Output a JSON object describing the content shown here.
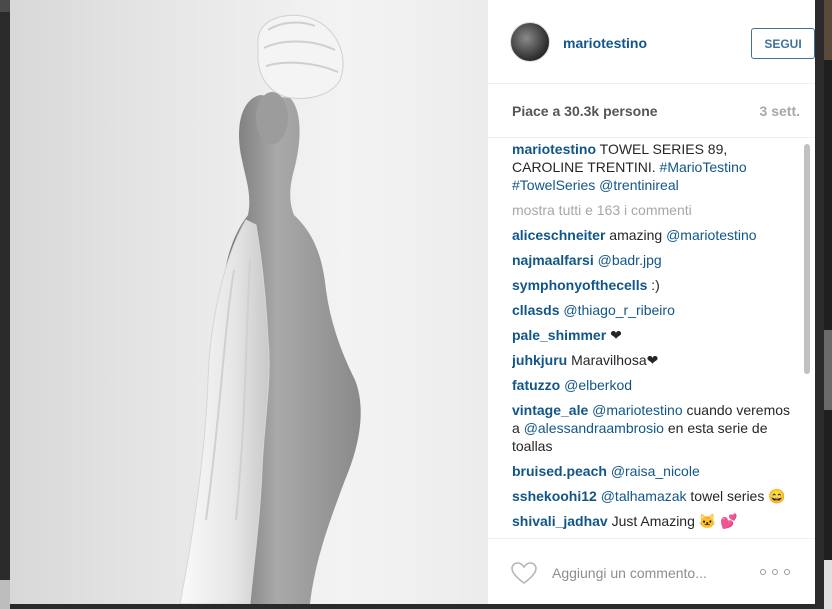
{
  "post": {
    "username": "mariotestino",
    "follow_label": "SEGUI",
    "likes": "Piace a 30.3k persone",
    "time": "3 sett."
  },
  "caption": {
    "user": "mariotestino",
    "text": "TOWEL SERIES 89, CAROLINE TRENTINI.",
    "tags": [
      "#MarioTestino",
      "#TowelSeries",
      "@trentinireal"
    ]
  },
  "view_all": "mostra tutti e 163 i commenti",
  "comments": [
    {
      "user": "aliceschneiter",
      "text": "amazing ",
      "tag": "@mariotestino"
    },
    {
      "user": "najmaalfarsi",
      "text": "",
      "tag": "@badr.jpg"
    },
    {
      "user": "symphonyofthecells",
      "text": ":)",
      "tag": ""
    },
    {
      "user": "cllasds",
      "text": "",
      "tag": "@thiago_r_ribeiro"
    },
    {
      "user": "pale_shimmer",
      "text": "❤",
      "tag": ""
    },
    {
      "user": "juhkjuru",
      "text": "Maravilhosa❤",
      "tag": ""
    },
    {
      "user": "fatuzzo",
      "text": "",
      "tag": "@elberkod"
    },
    {
      "user": "vintage_ale",
      "text_before": "",
      "tag1": "@mariotestino",
      "text_mid": " cuando veremos a ",
      "tag2": "@alessandraambrosio",
      "text_after": " en esta serie de toallas"
    },
    {
      "user": "bruised.peach",
      "text": "",
      "tag": "@raisa_nicole"
    },
    {
      "user": "sshekoohi12",
      "text_before": "",
      "tag1": "@talhamazak",
      "text_mid": " towel series 😄",
      "tag2": "",
      "text_after": ""
    },
    {
      "user": "shivali_jadhav",
      "text": "Just Amazing 🐱 💕",
      "tag": ""
    }
  ],
  "footer": {
    "comment_placeholder": "Aggiungi un commento...",
    "heart_icon": "heart-outline-icon",
    "more_icon": "more-options-icon"
  },
  "colors": {
    "link": "#125688",
    "follow": "#3f729b",
    "muted": "#a5a7aa"
  }
}
